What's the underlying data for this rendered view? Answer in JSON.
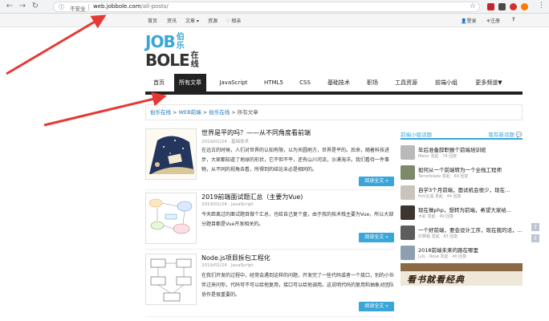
{
  "browser": {
    "security_label": "不安全",
    "url_host": "web.jobbole.com",
    "url_path": "/all-posts/"
  },
  "topbar": {
    "links": [
      "首页",
      "资讯",
      "文章",
      "资源",
      "相亲"
    ],
    "login": "登录",
    "register": "注册"
  },
  "logo": {
    "line1": "JOB",
    "line1_cn": "伯乐",
    "line2": "BOLE",
    "line2_cn": "在线"
  },
  "mainnav": {
    "items": [
      "首页",
      "所有文章",
      "JavaScript",
      "HTML5",
      "CSS",
      "基础技术",
      "职场",
      "工具资源",
      "前端小组",
      "更多频道▼"
    ]
  },
  "breadcrumb": {
    "crumb1": "伯乐在线",
    "sep": " > ",
    "crumb2": "WEB前端",
    "crumb3": "伯乐在线",
    "current": "所有文章"
  },
  "articles": [
    {
      "title": "世界是平的吗？——从不同角度看前端",
      "meta": "2019/02/24 · 基础技术",
      "desc": "在远古的时候，人们对世界的认知有限，以为天圆地方，世界是平的。后来，随着科技进步，大家都知道了地球的形状，它不但不平，还有山川河流，沙漠海洋。我们看待一件事物，从不同的视角去看，所得到的结论未必是相同的。",
      "read": "阅读全文 »"
    },
    {
      "title": "2019前端面试题汇总（主要为Vue)",
      "meta": "2019/02/24 · JavaScript",
      "desc": "今天距离过的面试题目做个汇总，也给自己复个盘，由于我的技术栈主要为Vue，所以大部分题目都是Vue开发相关的。",
      "read": "阅读全文 »"
    },
    {
      "title": "Node.js项目拆包工程化",
      "meta": "2019/02/24 · JavaScript",
      "desc": "在我们开发的过程中，经常会遇到这样的问题，开发完了一些代码或者一个接口，别的小伙伴过来问你，代码可不可以给他复用，接口可以给他调用。这说明代码的复用和抽象对团队协作是很重要的。",
      "read": "阅读全文 »"
    }
  ],
  "sidebar": {
    "title": "前端小组话题",
    "new_topic": "我有新话题",
    "topics": [
      {
        "title": "年后准备辞职报个前端培训班",
        "meta": "Melor 发起 · 74 回复"
      },
      {
        "title": "如何从一个前端转为一个全栈工程师",
        "meta": "Terrorblade 发起 · 69 回复"
      },
      {
        "title": "自学3个月前端，面试机会很少，现在...",
        "meta": "PoV云溪 发起 · 44 回复"
      },
      {
        "title": "现在做php，想转为前端，希望大家给...",
        "meta": "木彩 发起 · 49 回复"
      },
      {
        "title": "一个好前端，要会设计工序，现在我的话，...",
        "meta": "红狮蛆 发起 · 83 回复"
      },
      {
        "title": "2018前端未来的路在哪里",
        "meta": "July - Rose 发起 · 40 回复"
      }
    ],
    "banner_text": "看书就看经典"
  },
  "colors": {
    "accent": "#3aa6d8",
    "logo_blue": "#3aa6d8",
    "logo_dark": "#333333",
    "nav_dark": "#222222",
    "arrow_red": "#e53935"
  }
}
